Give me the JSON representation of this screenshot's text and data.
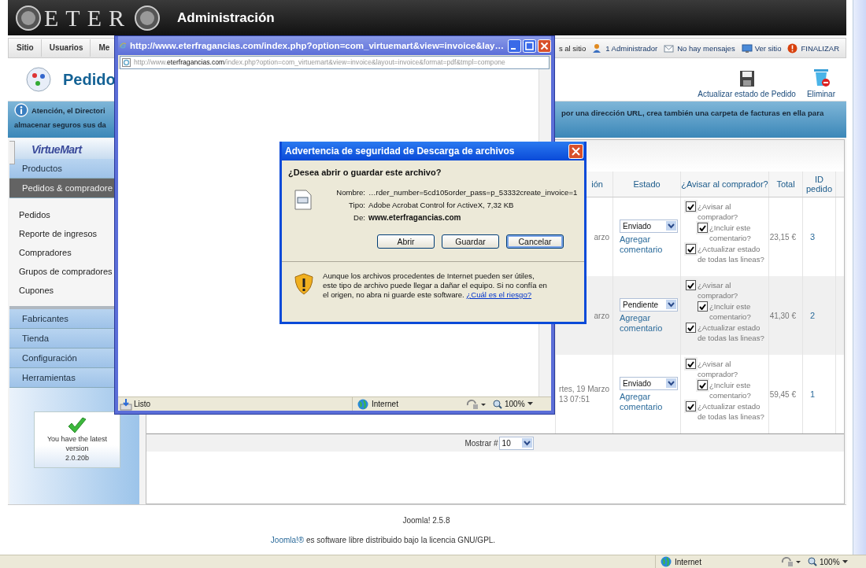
{
  "header": {
    "logo": "ETER",
    "title": "Administración"
  },
  "menu": {
    "left": [
      "Sitio",
      "Usuarios",
      "Me"
    ],
    "right": [
      {
        "label": "s al sitio",
        "kind": "plain"
      },
      {
        "label": "1 Administrador",
        "kind": "users"
      },
      {
        "label": "No hay mensajes",
        "kind": "messages"
      },
      {
        "label": "Ver sitio",
        "kind": "site"
      },
      {
        "label": "FINALIZAR",
        "kind": "logout"
      }
    ]
  },
  "page_title": "Pedido",
  "toolbar": [
    {
      "label": "Actualizar estado de Pedido",
      "kind": "save"
    },
    {
      "label": "Eliminar",
      "kind": "delete"
    }
  ],
  "notice": {
    "left_lines": [
      "Atención, el Directori",
      "almacenar seguros sus da"
    ],
    "right_text": "por una dirección URL, crea también una carpeta de facturas en ella para"
  },
  "sidebar": {
    "logo": "VirtueMart",
    "sections": [
      {
        "label": "Productos",
        "expanded": false
      },
      {
        "label": "Pedidos & compradore",
        "expanded": true,
        "children": [
          "Pedidos",
          "Reporte de ingresos",
          "Compradores",
          "Grupos de compradores",
          "Cupones"
        ]
      },
      {
        "label": "Fabricantes",
        "expanded": false
      },
      {
        "label": "Tienda",
        "expanded": false
      },
      {
        "label": "Configuración",
        "expanded": false
      },
      {
        "label": "Herramientas",
        "expanded": false
      }
    ],
    "version_box": {
      "text": "You have the latest version",
      "version": "2.0.20b"
    }
  },
  "table": {
    "columns": [
      "ión",
      "Estado",
      "¿Avisar al comprador?",
      "Total",
      "ID pedido"
    ],
    "rows": [
      {
        "date_lines": [
          "arzo"
        ],
        "status": "Enviado",
        "comment_link": "Agregar comentario",
        "notify": [
          {
            "label": "¿Avisar al comprador?",
            "checked": true
          },
          {
            "label": "¿Incluir este comentario?",
            "checked": true
          },
          {
            "label": "¿Actualizar estado de todas las lineas?",
            "checked": true
          }
        ],
        "total": "23,15 €",
        "id": "3"
      },
      {
        "date_lines": [
          "arzo"
        ],
        "status": "Pendiente",
        "comment_link": "Agregar comentario",
        "notify": [
          {
            "label": "¿Avisar al comprador?",
            "checked": true
          },
          {
            "label": "¿Incluir este comentario?",
            "checked": true
          },
          {
            "label": "¿Actualizar estado de todas las lineas?",
            "checked": true
          }
        ],
        "total": "41,30 €",
        "id": "2"
      },
      {
        "date_lines": [
          "rtes, 19 Marzo",
          "13 07:51"
        ],
        "status": "Enviado",
        "comment_link": "Agregar comentario",
        "notify": [
          {
            "label": "¿Avisar al comprador?",
            "checked": true
          },
          {
            "label": "¿Incluir este comentario?",
            "checked": true
          },
          {
            "label": "¿Actualizar estado de todas las lineas?",
            "checked": true
          }
        ],
        "total": "59,45 €",
        "id": "1"
      }
    ],
    "pagination": {
      "label": "Mostrar #",
      "value": "10"
    }
  },
  "footer": {
    "version": "Joomla! 2.5.8",
    "license_link": "Joomla!®",
    "license_text": " es software libre distribuido bajo la licencia GNU/GPL."
  },
  "popup": {
    "title": "http://www.eterfragancias.com/index.php?option=com_virtuemart&view=invoice&lay…",
    "address_prefix": "http://www.",
    "address_domain": "eterfragancias.com",
    "address_path": "/index.php?option=com_virtuemart&view=invoice&layout=invoice&format=pdf&tmpl=compone",
    "status": "Listo",
    "zone": "Internet",
    "zoom": "100%"
  },
  "dialog": {
    "title": "Advertencia de seguridad de Descarga de archivos",
    "question": "¿Desea abrir o guardar este archivo?",
    "fields": [
      {
        "label": "Nombre:",
        "value": "…rder_number=5cd105order_pass=p_53332create_invoice=1",
        "emphasis": false
      },
      {
        "label": "Tipo:",
        "value": "Adobe Acrobat Control for ActiveX, 7,32 KB",
        "emphasis": false
      },
      {
        "label": "De:",
        "value": "www.eterfragancias.com",
        "emphasis": true
      }
    ],
    "buttons": [
      {
        "label": "Abrir",
        "focused": false
      },
      {
        "label": "Guardar",
        "focused": false
      },
      {
        "label": "Cancelar",
        "focused": true
      }
    ],
    "warning": "Aunque los archivos procedentes de Internet pueden ser útiles, este tipo de archivo puede llegar a dañar el equipo. Si no confía en el origen, no abra ni guarde este software. ",
    "risk_link": "¿Cuál es el riesgo?"
  },
  "browser_status": {
    "zone": "Internet",
    "zoom": "100%"
  }
}
